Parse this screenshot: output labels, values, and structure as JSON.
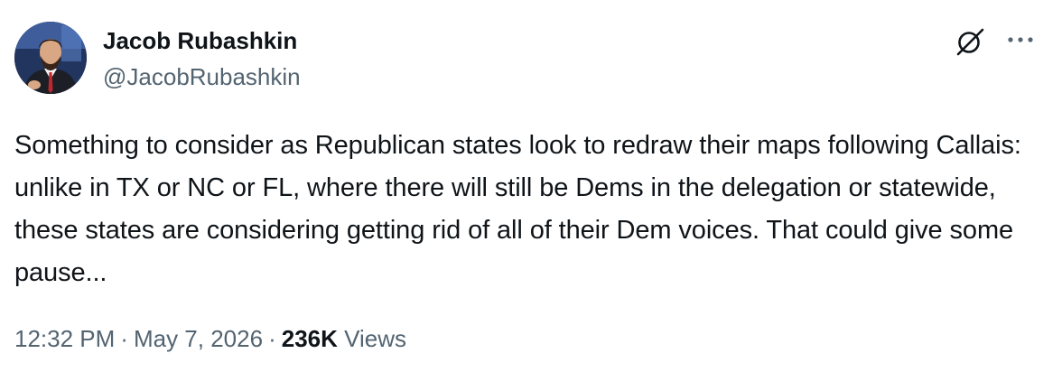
{
  "author": {
    "display_name": "Jacob Rubashkin",
    "handle": "@JacobRubashkin",
    "avatar_icon": "profile-photo"
  },
  "header_icons": {
    "grok": "grok-icon",
    "more": "more-options-icon"
  },
  "tweet": {
    "text": "Something to consider as Republican states look to redraw their maps following Callais: unlike in TX or NC or FL, where there will still be Dems in the delegation or statewide, these states are considering getting rid of all of their Dem voices. That could give some pause..."
  },
  "meta": {
    "time": "12:32 PM",
    "separator": "·",
    "date": "May 7, 2026",
    "views_count": "236K",
    "views_label": "Views"
  },
  "colors": {
    "text_primary": "#0f1419",
    "text_secondary": "#536471",
    "background": "#ffffff"
  }
}
